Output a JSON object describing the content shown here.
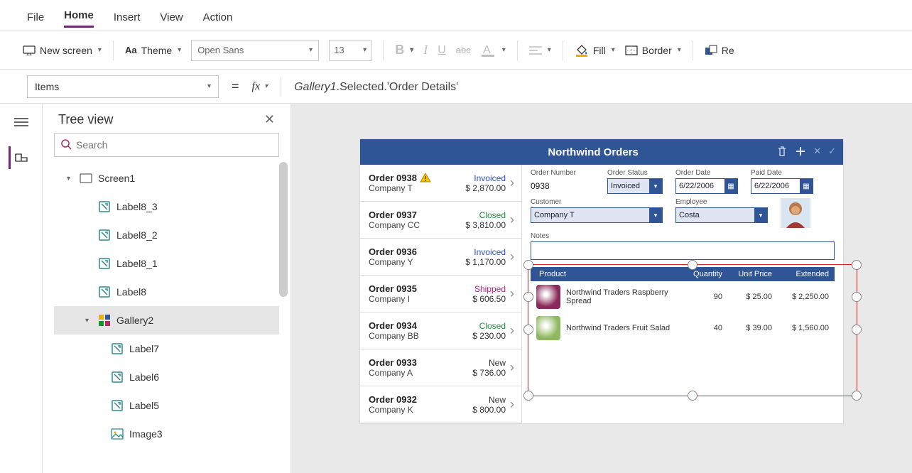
{
  "menu": [
    "File",
    "Home",
    "Insert",
    "View",
    "Action"
  ],
  "menu_active": 1,
  "ribbon": {
    "new_screen": "New screen",
    "theme": "Theme",
    "font": "Open Sans",
    "size": "13",
    "fill": "Fill",
    "border": "Border",
    "reorder": "Re"
  },
  "formula": {
    "property": "Items",
    "fx": "fx",
    "expr_italic": "Gallery1",
    "expr_rest": ".Selected.'Order Details'"
  },
  "tree": {
    "title": "Tree view",
    "search_placeholder": "Search",
    "nodes": [
      {
        "level": 1,
        "type": "screen",
        "caret": "▾",
        "label": "Screen1"
      },
      {
        "level": 2,
        "type": "label",
        "label": "Label8_3"
      },
      {
        "level": 2,
        "type": "label",
        "label": "Label8_2"
      },
      {
        "level": 2,
        "type": "label",
        "label": "Label8_1"
      },
      {
        "level": 2,
        "type": "label",
        "label": "Label8"
      },
      {
        "level": 2,
        "type": "gallery",
        "caret": "▾",
        "label": "Gallery2",
        "sel": true
      },
      {
        "level": 3,
        "type": "label",
        "label": "Label7"
      },
      {
        "level": 3,
        "type": "label",
        "label": "Label6"
      },
      {
        "level": 3,
        "type": "label",
        "label": "Label5"
      },
      {
        "level": 3,
        "type": "image",
        "label": "Image3"
      }
    ]
  },
  "app": {
    "title": "Northwind Orders",
    "orders": [
      {
        "num": "Order 0938",
        "co": "Company T",
        "status": "Invoiced",
        "amt": "$ 2,870.00",
        "warn": true
      },
      {
        "num": "Order 0937",
        "co": "Company CC",
        "status": "Closed",
        "amt": "$ 3,810.00"
      },
      {
        "num": "Order 0936",
        "co": "Company Y",
        "status": "Invoiced",
        "amt": "$ 1,170.00"
      },
      {
        "num": "Order 0935",
        "co": "Company I",
        "status": "Shipped",
        "amt": "$ 606.50"
      },
      {
        "num": "Order 0934",
        "co": "Company BB",
        "status": "Closed",
        "amt": "$ 230.00"
      },
      {
        "num": "Order 0933",
        "co": "Company A",
        "status": "New",
        "amt": "$ 736.00"
      },
      {
        "num": "Order 0932",
        "co": "Company K",
        "status": "New",
        "amt": "$ 800.00"
      }
    ],
    "fields": {
      "order_number_label": "Order Number",
      "order_number": "0938",
      "order_status_label": "Order Status",
      "order_status": "Invoiced",
      "order_date_label": "Order Date",
      "order_date": "6/22/2006",
      "paid_date_label": "Paid Date",
      "paid_date": "6/22/2006",
      "customer_label": "Customer",
      "customer": "Company T",
      "employee_label": "Employee",
      "employee": "Costa",
      "notes_label": "Notes"
    },
    "grid": {
      "headers": {
        "product": "Product",
        "qty": "Quantity",
        "price": "Unit Price",
        "ext": "Extended"
      },
      "rows": [
        {
          "product": "Northwind Traders Raspberry Spread",
          "qty": "90",
          "price": "$ 25.00",
          "ext": "$ 2,250.00",
          "thumb": "#8a2a5a"
        },
        {
          "product": "Northwind Traders Fruit Salad",
          "qty": "40",
          "price": "$ 39.00",
          "ext": "$ 1,560.00",
          "thumb": "#8fb960"
        }
      ]
    }
  }
}
